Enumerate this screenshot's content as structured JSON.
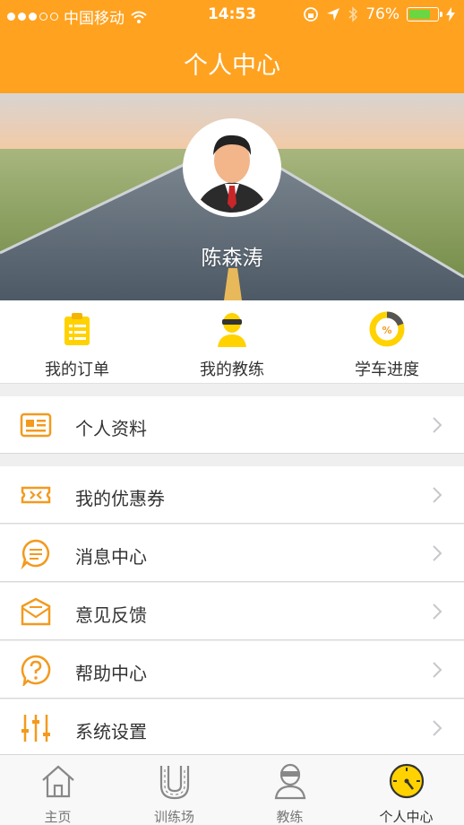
{
  "status_bar": {
    "carrier": "中国移动",
    "time": "14:53",
    "battery": "76%",
    "battery_level": 0.76
  },
  "header": {
    "title": "个人中心"
  },
  "profile": {
    "name": "陈森涛"
  },
  "quick_actions": [
    {
      "label": "我的订单",
      "icon": "clipboard-icon"
    },
    {
      "label": "我的教练",
      "icon": "coach-icon"
    },
    {
      "label": "学车进度",
      "icon": "progress-icon"
    }
  ],
  "menu": {
    "profile_label": "个人资料",
    "coupons_label": "我的优惠券",
    "messages_label": "消息中心",
    "feedback_label": "意见反馈",
    "help_label": "帮助中心",
    "settings_label": "系统设置"
  },
  "tabs": [
    {
      "label": "主页",
      "icon": "home-icon"
    },
    {
      "label": "训练场",
      "icon": "track-icon"
    },
    {
      "label": "教练",
      "icon": "coach-icon"
    },
    {
      "label": "个人中心",
      "icon": "speedometer-icon",
      "active": true
    }
  ],
  "colors": {
    "accent": "#ffa21f",
    "icon_orange": "#f39a1e",
    "icon_yellow": "#ffd200"
  }
}
